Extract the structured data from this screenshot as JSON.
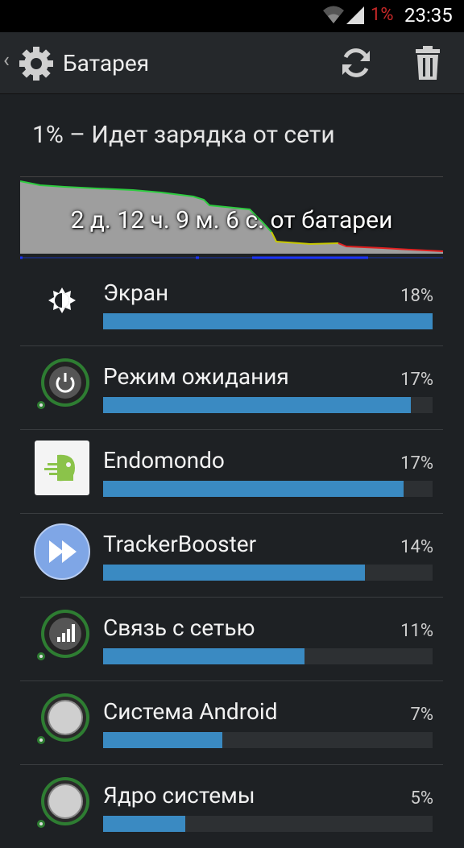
{
  "status_bar": {
    "battery_percent": "1%",
    "time": "23:35"
  },
  "action_bar": {
    "title": "Батарея"
  },
  "battery_status": "1% – Идет зарядка от сети",
  "graph": {
    "duration_text": "2 д. 12 ч. 9 м. 6 с. от батареи"
  },
  "items": [
    {
      "label": "Экран",
      "percent": "18%",
      "fill": 1.0,
      "icon": "brightness-icon"
    },
    {
      "label": "Режим ожидания",
      "percent": "17%",
      "fill": 0.934,
      "icon": "standby-power-icon"
    },
    {
      "label": "Endomondo",
      "percent": "17%",
      "fill": 0.912,
      "icon": "endomondo-app-icon"
    },
    {
      "label": "TrackerBooster",
      "percent": "14%",
      "fill": 0.794,
      "icon": "trackerbooster-app-icon"
    },
    {
      "label": "Связь с сетью",
      "percent": "11%",
      "fill": 0.611,
      "icon": "cell-signal-icon"
    },
    {
      "label": "Система Android",
      "percent": "7%",
      "fill": 0.361,
      "icon": "android-system-icon"
    },
    {
      "label": "Ядро системы",
      "percent": "5%",
      "fill": 0.25,
      "icon": "android-kernel-icon"
    }
  ]
}
